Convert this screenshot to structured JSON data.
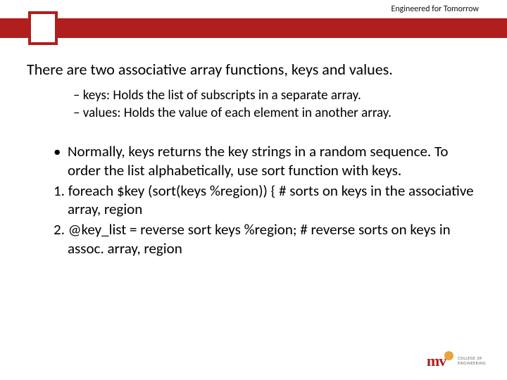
{
  "header": {
    "tagline": "Engineered for Tomorrow"
  },
  "content": {
    "intro": "There are two associative array functions, keys and values.",
    "dash_items": [
      "keys: Holds the list of subscripts in a separate array.",
      "values: Holds the value of each element in another array."
    ],
    "bullet_items": [
      {
        "marker": "•",
        "text": "Normally, keys returns the key strings in a random sequence. To order the list alphabetically, use sort function with keys."
      },
      {
        "marker": "1.",
        "text": "foreach $key (sort(keys %region)) {   # sorts on keys in the associative array, region"
      },
      {
        "marker": "2.",
        "text": "@key_list = reverse sort keys %region;  # reverse sorts on keys in assoc. array, region"
      }
    ]
  },
  "footer": {
    "logo_mark": "mv",
    "logo_lines": [
      "COLLEGE OF",
      "ENGINEERING",
      ""
    ]
  }
}
